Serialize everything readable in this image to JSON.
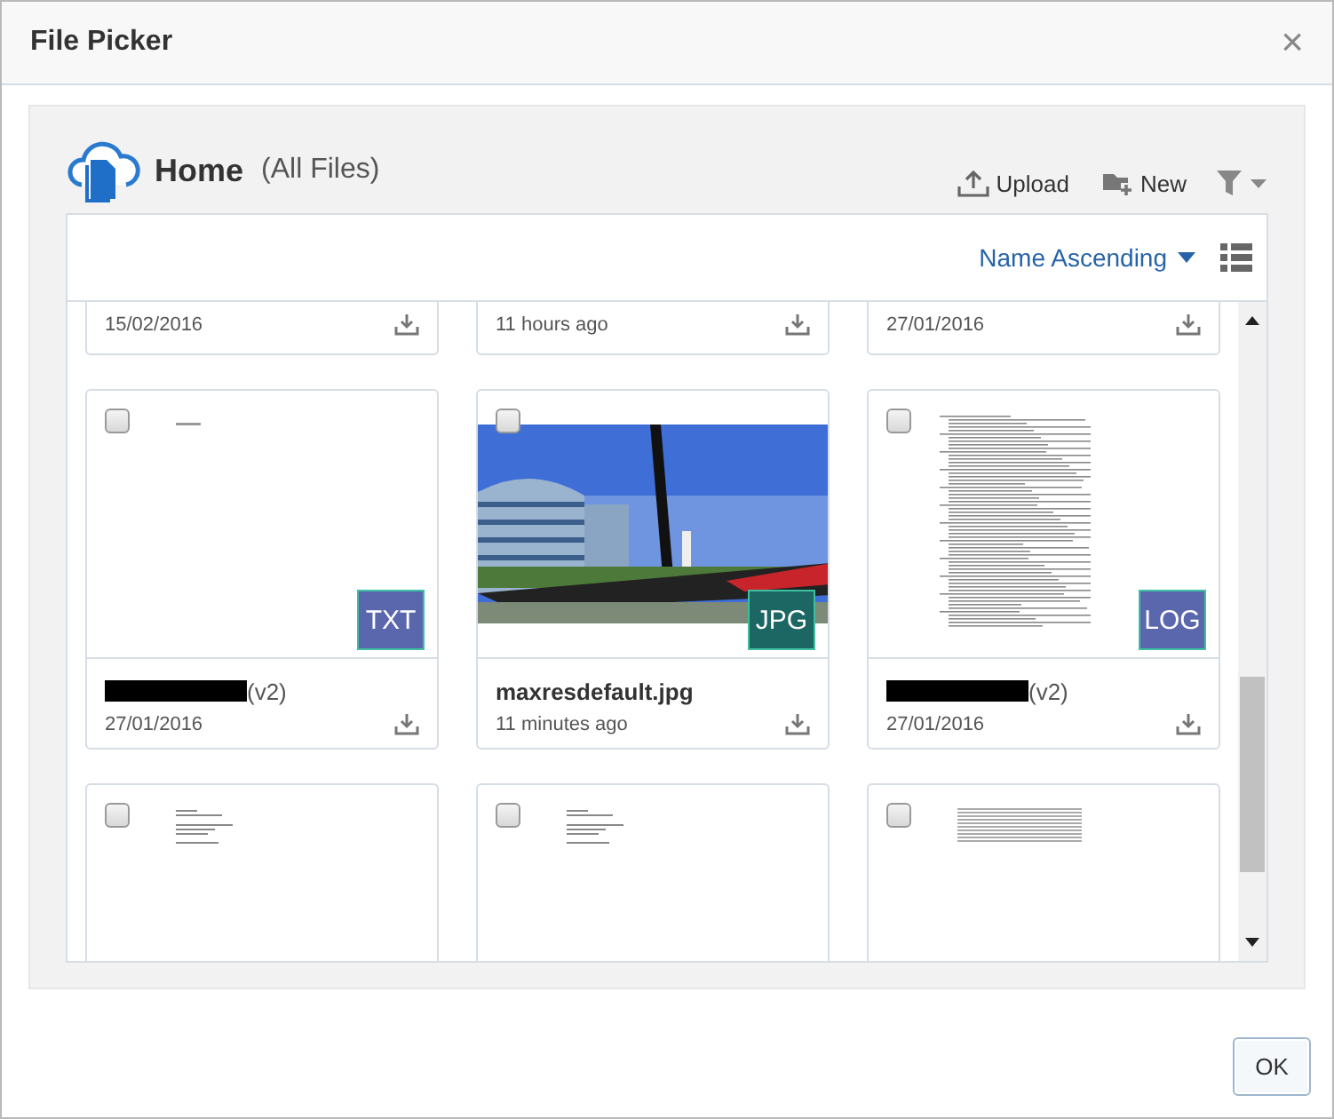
{
  "window": {
    "title": "File Picker",
    "close": "×"
  },
  "header": {
    "title": "Home",
    "subtitle": "(All Files)",
    "actions": [
      {
        "label": "Upload",
        "kind": "upload"
      },
      {
        "label": "New",
        "kind": "new"
      }
    ]
  },
  "sort": {
    "label": "Name Ascending"
  },
  "files": [
    {
      "kind": "cut-top",
      "date": "15/02/2016"
    },
    {
      "kind": "cut-top",
      "date": "11 hours ago"
    },
    {
      "kind": "cut-top",
      "date": "27/01/2016"
    },
    {
      "kind": "full",
      "thumbnail": {
        "kind": "blank-text"
      },
      "badge": "TXT",
      "color": "#5b67ad",
      "name": "(v2)",
      "redacted": true,
      "date": "27/01/2016",
      "checked": false
    },
    {
      "kind": "full",
      "badge": "JPG",
      "color": "#1c6663",
      "name": "maxresdefault.jpg",
      "redacted": false,
      "date": "11 minutes ago",
      "checked": false
    },
    {
      "kind": "full",
      "thumbnail": {
        "kind": "long-text"
      },
      "badge": "LOG",
      "color": "#5b67ad",
      "name": "(v2)",
      "redacted": true,
      "date": "27/01/2016",
      "checked": false
    },
    {
      "kind": "cut-bottom",
      "thumbnail": {
        "kind": "letter"
      },
      "checked": false
    },
    {
      "kind": "cut-bottom",
      "thumbnail": {
        "kind": "letter"
      },
      "checked": false
    },
    {
      "kind": "cut-bottom",
      "thumbnail": {
        "kind": "table"
      },
      "checked": false
    }
  ],
  "buttons": [
    {
      "label": "OK"
    }
  ]
}
